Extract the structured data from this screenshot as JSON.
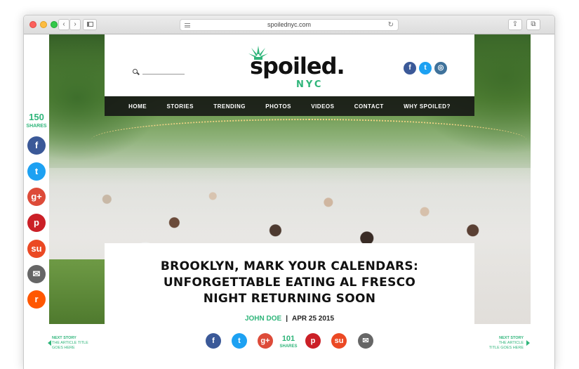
{
  "browser": {
    "url": "spoilednyc.com",
    "nav_back": "‹",
    "nav_forward": "›",
    "reload": "↻",
    "share": "⇪",
    "tabs": "⧉",
    "new_tab": "+"
  },
  "site": {
    "logo_word": "spoiled.",
    "logo_city": "NYC",
    "accent_color": "#2fb57a",
    "nav": [
      "HOME",
      "STORIES",
      "TRENDING",
      "PHOTOS",
      "VIDEOS",
      "CONTACT",
      "WHY SPOILED?"
    ]
  },
  "header_social": [
    {
      "icon": "facebook-icon",
      "glyph": "f",
      "color": "#3b5998"
    },
    {
      "icon": "twitter-icon",
      "glyph": "t",
      "color": "#1da1f2"
    },
    {
      "icon": "instagram-icon",
      "glyph": "◎",
      "color": "#3f729b"
    }
  ],
  "sidebar": {
    "share_count": "150",
    "share_label": "SHARES",
    "buttons": [
      {
        "icon": "facebook-icon",
        "glyph": "f",
        "color": "#3b5998"
      },
      {
        "icon": "twitter-icon",
        "glyph": "t",
        "color": "#1da1f2"
      },
      {
        "icon": "google-plus-icon",
        "glyph": "g+",
        "color": "#dd4b39"
      },
      {
        "icon": "pinterest-icon",
        "glyph": "p",
        "color": "#cb2027"
      },
      {
        "icon": "stumbleupon-icon",
        "glyph": "su",
        "color": "#eb4924"
      },
      {
        "icon": "email-icon",
        "glyph": "✉",
        "color": "#666666"
      },
      {
        "icon": "reddit-icon",
        "glyph": "r",
        "color": "#ff5700"
      }
    ]
  },
  "article": {
    "headline_lines": [
      "BROOKLYN, MARK YOUR CALENDARS:",
      "UNFORGETTABLE EATING AL FRESCO",
      "NIGHT RETURNING SOON"
    ],
    "author": "JOHN DOE",
    "separator": "|",
    "date": "APR 25 2015",
    "share_count": "101",
    "share_label": "SHARES"
  },
  "bottom_share": [
    {
      "icon": "facebook-icon",
      "glyph": "f",
      "color": "#3b5998"
    },
    {
      "icon": "twitter-icon",
      "glyph": "t",
      "color": "#1da1f2"
    },
    {
      "icon": "google-plus-icon",
      "glyph": "g+",
      "color": "#dd4b39"
    },
    {
      "icon": "pinterest-icon",
      "glyph": "p",
      "color": "#cb2027"
    },
    {
      "icon": "stumbleupon-icon",
      "glyph": "su",
      "color": "#eb4924"
    },
    {
      "icon": "email-icon",
      "glyph": "✉",
      "color": "#666666"
    }
  ],
  "next_story_left": {
    "label": "NEXT STORY",
    "line1": "THE ARTICLE TITLE",
    "line2": "GOES HERE"
  },
  "next_story_right": {
    "label": "NEXT STORY",
    "line1": "THE ARTICLE",
    "line2": "TITLE GOES HERE"
  }
}
